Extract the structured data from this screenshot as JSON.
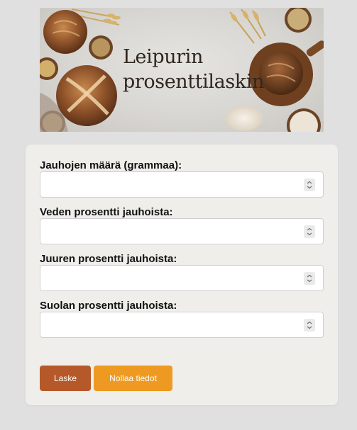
{
  "banner": {
    "title_line1": "Leipurin",
    "title_line2": "prosenttilaskin"
  },
  "form": {
    "fields": [
      {
        "label": "Jauhojen määrä (grammaa):",
        "value": ""
      },
      {
        "label": "Veden prosentti jauhoista:",
        "value": ""
      },
      {
        "label": "Juuren prosentti jauhoista:",
        "value": ""
      },
      {
        "label": "Suolan prosentti jauhoista:",
        "value": ""
      }
    ],
    "calculate_label": "Laske",
    "reset_label": "Nollaa tiedot"
  },
  "colors": {
    "page_background": "#e0e0e0",
    "card_background": "#efeeeb",
    "calculate_button": "#b5592a",
    "reset_button": "#ee9a22"
  }
}
